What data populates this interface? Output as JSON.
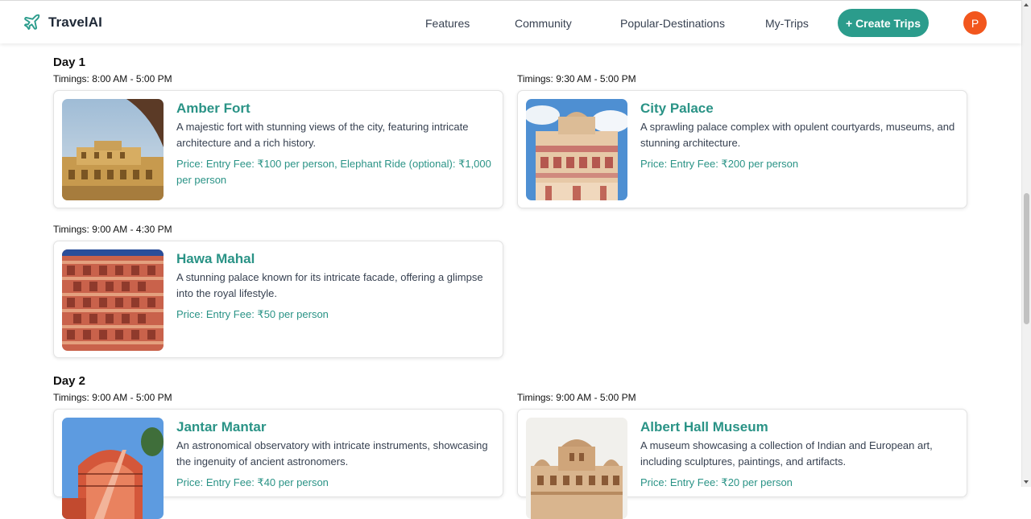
{
  "brand": {
    "name": "TravelAI",
    "icon": "plane-icon"
  },
  "nav": {
    "links": [
      "Features",
      "Community",
      "Popular-Destinations",
      "My-Trips"
    ],
    "create_button": "+ Create Trips",
    "avatar_initial": "P"
  },
  "colors": {
    "accent": "#2b9c8c",
    "title_teal": "#2a9386",
    "avatar": "#f2561d"
  },
  "days": [
    {
      "title": "Day 1",
      "places": [
        {
          "timing": "Timings: 8:00 AM - 5:00 PM",
          "name": "Amber Fort",
          "description": "A majestic fort with stunning views of the city, featuring intricate architecture and a rich history.",
          "price": "Price: Entry Fee: ₹100 per person, Elephant Ride (optional): ₹1,000 per person"
        },
        {
          "timing": "Timings: 9:30 AM - 5:00 PM",
          "name": "City Palace",
          "description": "A sprawling palace complex with opulent courtyards, museums, and stunning architecture.",
          "price": "Price: Entry Fee: ₹200 per person"
        },
        {
          "timing": "Timings: 9:00 AM - 4:30 PM",
          "name": "Hawa Mahal",
          "description": "A stunning palace known for its intricate facade, offering a glimpse into the royal lifestyle.",
          "price": "Price: Entry Fee: ₹50 per person"
        }
      ]
    },
    {
      "title": "Day 2",
      "places": [
        {
          "timing": "Timings: 9:00 AM - 5:00 PM",
          "name": "Jantar Mantar",
          "description": "An astronomical observatory with intricate instruments, showcasing the ingenuity of ancient astronomers.",
          "price": "Price: Entry Fee: ₹40 per person"
        },
        {
          "timing": "Timings: 9:00 AM - 5:00 PM",
          "name": "Albert Hall Museum",
          "description": "A museum showcasing a collection of Indian and European art, including sculptures, paintings, and artifacts.",
          "price": "Price: Entry Fee: ₹20 per person"
        }
      ]
    }
  ]
}
